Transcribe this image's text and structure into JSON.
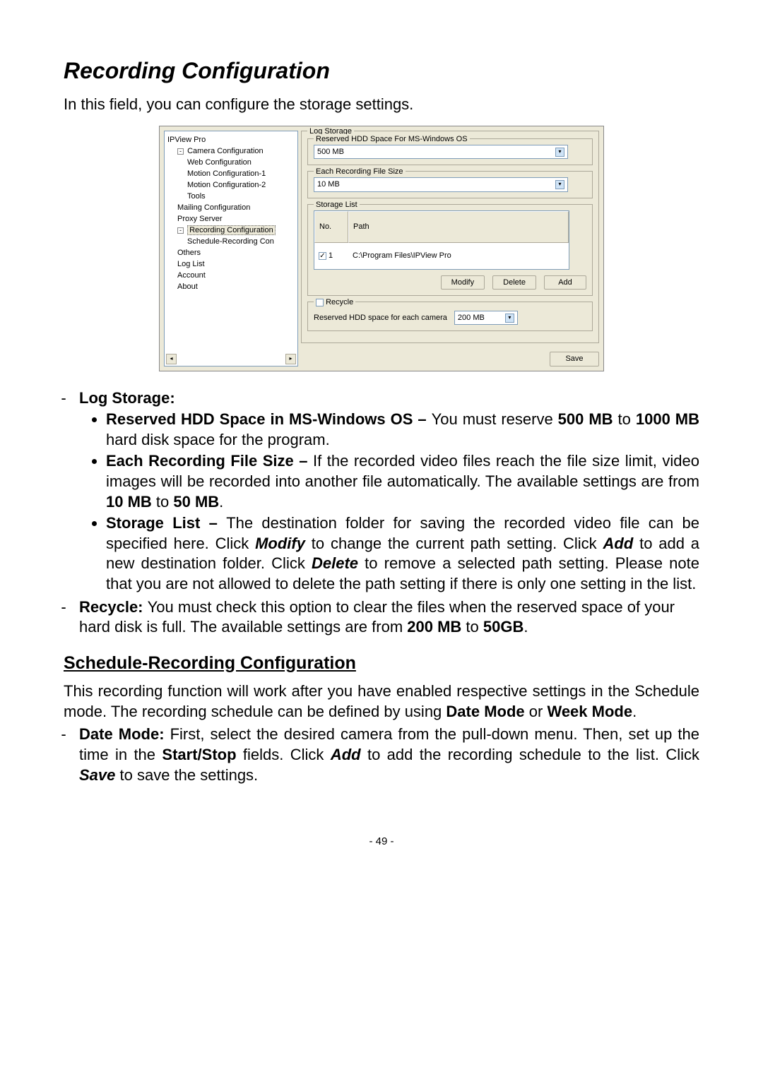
{
  "title": "Recording Configuration",
  "intro": "In this field, you can configure the storage settings.",
  "tree": {
    "root": "IPView Pro",
    "camera_config": "Camera Configuration",
    "web_config": "Web Configuration",
    "motion1": "Motion Configuration-1",
    "motion2": "Motion Configuration-2",
    "tools": "Tools",
    "mailing": "Mailing Configuration",
    "proxy": "Proxy Server",
    "recording_config": "Recording Configuration",
    "schedule_rec": "Schedule-Recording Con",
    "others": "Others",
    "log_list": "Log List",
    "account": "Account",
    "about": "About"
  },
  "panel": {
    "log_storage": "Log Storage",
    "reserved_label": "Reserved HDD Space For MS-Windows OS",
    "reserved_value": "500 MB",
    "each_label": "Each Recording File Size",
    "each_value": "10 MB",
    "storage_list": "Storage List",
    "col_no": "No.",
    "col_path": "Path",
    "row_no": "1",
    "row_path": "C:\\Program Files\\IPView Pro",
    "modify": "Modify",
    "delete": "Delete",
    "add": "Add",
    "recycle": "Recycle",
    "reserved_each_cam": "Reserved HDD space for each camera",
    "reserved_each_val": "200 MB",
    "save": "Save"
  },
  "doc": {
    "log_storage": "Log Storage:",
    "reserved_line_a": "Reserved HDD Space in MS-Windows OS – ",
    "reserved_line_b": "You must  reserve ",
    "reserved_line_c": "500 MB",
    "reserved_line_d": " to ",
    "reserved_line_e": "1000 MB",
    "reserved_line_f": " hard disk space for the program.",
    "each_a": "Each Recording File Size – ",
    "each_b": "If the recorded video files reach the file size limit, video images will be recorded into another file automatically.  The available settings are from ",
    "each_c": "10 MB",
    "each_d": " to ",
    "each_e": "50 MB",
    "each_f": ".",
    "storage_a": "Storage List – ",
    "storage_b": "The destination folder for saving the recorded video file can be specified here.  Click ",
    "storage_c": "Modify",
    "storage_d": " to change the current path setting.  Click ",
    "storage_e": "Add",
    "storage_f": " to add a new destination folder.  Click ",
    "storage_g": "Delete",
    "storage_h": " to remove a selected path setting.  Please note that you are not allowed to delete the path setting if there is only one setting in the list.",
    "recycle_a": "Recycle: ",
    "recycle_b": "You must check this option to clear the files when the reserved space of your hard disk is full.  The available settings are from ",
    "recycle_c": "200 MB",
    "recycle_d": " to ",
    "recycle_e": "50GB",
    "recycle_f": ".",
    "subheading": "Schedule-Recording Configuration",
    "sched_p1a": "This recording function will work after you have enabled respective settings in the Schedule mode.  The recording schedule can be defined by using ",
    "sched_p1b": "Date Mode",
    "sched_p1c": " or ",
    "sched_p1d": "Week Mode",
    "sched_p1e": ".",
    "date_a": "Date Mode: ",
    "date_b": "First, select the desired camera from the pull-down menu.  Then, set up the time in the ",
    "date_c": "Start/Stop",
    "date_d": " fields.  Click ",
    "date_e": "Add",
    "date_f": " to add the recording schedule to the list.  Click ",
    "date_g": "Save",
    "date_h": " to save the settings."
  },
  "pagenum": "- 49 -"
}
